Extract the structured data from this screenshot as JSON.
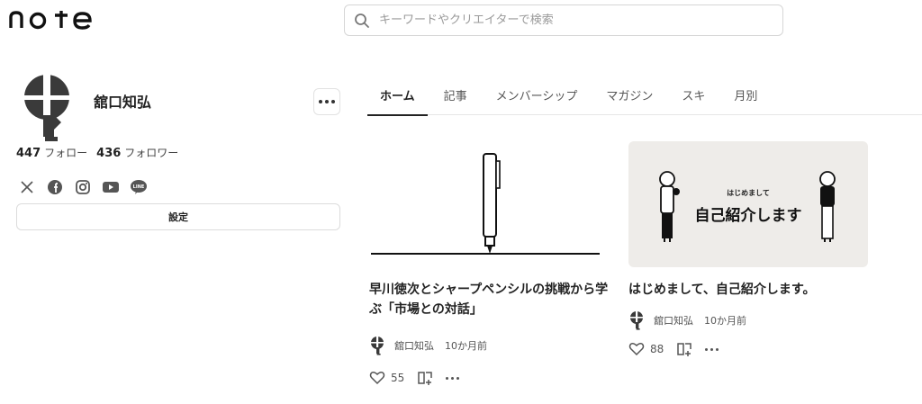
{
  "brand": {
    "logo_text": "note"
  },
  "search": {
    "placeholder": "キーワードやクリエイターで検索"
  },
  "profile": {
    "name": "舘口知弘",
    "follow_count": "447",
    "follow_label": "フォロー",
    "follower_count": "436",
    "follower_label": "フォロワー",
    "socials": [
      "x-icon",
      "facebook-icon",
      "instagram-icon",
      "youtube-icon",
      "line-icon"
    ],
    "line_text": "LINE",
    "settings_label": "設定"
  },
  "tabs": [
    {
      "label": "ホーム",
      "active": true
    },
    {
      "label": "記事"
    },
    {
      "label": "メンバーシップ"
    },
    {
      "label": "マガジン"
    },
    {
      "label": "スキ"
    },
    {
      "label": "月別"
    }
  ],
  "articles": [
    {
      "title": "早川徳次とシャープペンシルの挑戦から学ぶ「市場との対話」",
      "author": "舘口知弘",
      "time": "10か月前",
      "likes": "55"
    },
    {
      "title": "はじめまして、自己紹介します。",
      "thumb_small": "はじめまして",
      "thumb_big": "自己紹介します",
      "author": "舘口知弘",
      "time": "10か月前",
      "likes": "88"
    }
  ],
  "colors": {
    "text": "#222222",
    "muted": "#555555",
    "border": "#dcdcdc",
    "thumb_bg": "#eeece9"
  }
}
